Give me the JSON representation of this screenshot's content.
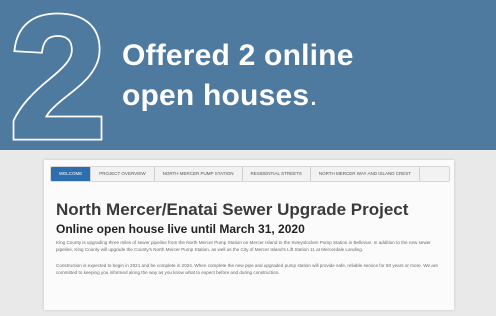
{
  "banner": {
    "number": "2",
    "headline_line1_prefix": "Offered ",
    "headline_line1_bold": "2 online",
    "headline_line2": "open houses",
    "headline_period": "."
  },
  "colors": {
    "banner_bg": "#4f7aa0",
    "tab_active": "#2d6fae"
  },
  "screenshot": {
    "tabs": [
      "Welcome",
      "Project overview",
      "North Mercer Pump Station",
      "Residential streets",
      "North Mercer Way and Island Crest"
    ],
    "active_tab": 0,
    "title": "North Mercer/Enatai Sewer Upgrade Project",
    "subtitle": "Online open house live until March 31, 2020",
    "paragraph1": "King County is upgrading three miles of sewer pipeline from the North Mercer Pump Station on Mercer Island to the Sweyolocken Pump Station in Bellevue. In addition to the new sewer pipeline, King County will upgrade the County's North Mercer Pump Station, as well as the City of Mercer Island's Lift Station 11 at Mercerdale Landing.",
    "paragraph2": "Construction is expected to begin in 2021 and be complete in 2024. When complete the new pipe and upgraded pump station will provide safe, reliable service for 50 years or more. We are committed to keeping you informed along the way as you know what to expect before and during construction."
  }
}
